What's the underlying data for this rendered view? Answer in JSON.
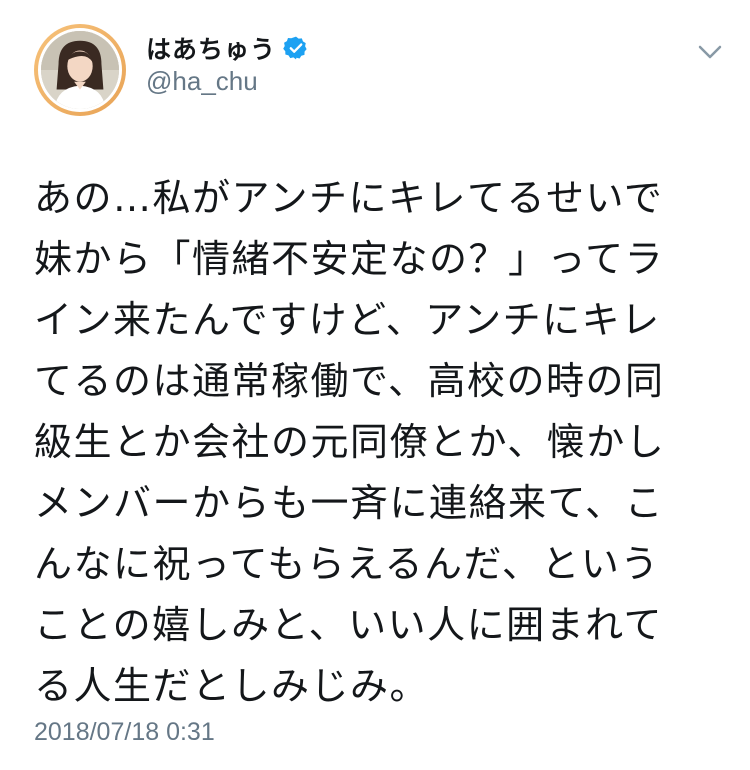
{
  "user": {
    "display_name": "はあちゅう",
    "handle": "@ha_chu",
    "verified": true,
    "avatar_icon": "profile-photo"
  },
  "tweet": {
    "text": "あの…私がアンチにキレてるせいで\n妹から「情緒不安定なの？」ってラ\nイン来たんですけど、アンチにキレ\nてるのは通常稼働で、高校の時の同\n級生とか会社の元同僚とか、懐かし\nメンバーからも一斉に連絡来て、こ\nんなに祝ってもらえるんだ、という\nことの嬉しみと、いい人に囲まれて\nる人生だとしみじみ。",
    "timestamp": "2018/07/18 0:31"
  },
  "icons": {
    "verified": "verified-badge-icon",
    "menu": "chevron-down-icon"
  },
  "colors": {
    "text": "#14171a",
    "secondary": "#657786",
    "verified_blue": "#1da1f2",
    "caret": "#8899a6"
  }
}
